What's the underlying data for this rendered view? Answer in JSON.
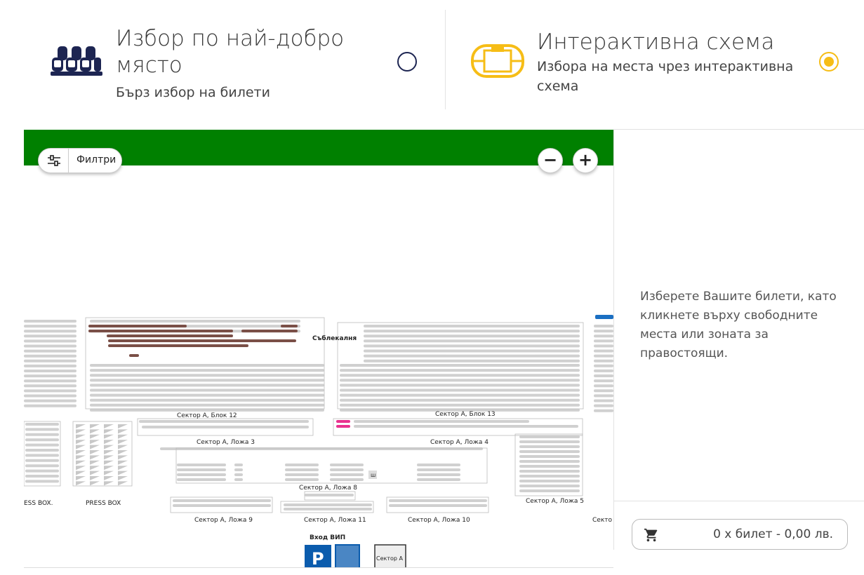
{
  "modes": {
    "best": {
      "title": "Избор по най-добро място",
      "subtitle": "Бърз избор на билети",
      "selected": false,
      "icon": "theater-seats-icon"
    },
    "map": {
      "title": "Интерактивна схема",
      "subtitle": "Избора на места чрез интерактивна схема",
      "selected": true,
      "icon": "stadium-icon"
    }
  },
  "map": {
    "filter_label": "Филтри",
    "zoom_out": "−",
    "zoom_in": "+",
    "labels": {
      "changing_room": "Съблекалня",
      "block12": "Сектор А, Блок 12",
      "block13": "Сектор А, Блок 13",
      "loge3": "Сектор А, Ложа 3",
      "loge4": "Сектор А, Ложа 4",
      "loge5": "Сектор А, Ложа 5",
      "loge8": "Сектор А, Ложа 8",
      "loge9": "Сектор А, Ложа 9",
      "loge10": "Сектор А, Ложа 10",
      "loge11": "Сектор А, Ложа 11",
      "press_left": "ESS BOX.",
      "press": "PRESS BOX",
      "vip_entrance": "Вход ВИП",
      "parking": "P",
      "sector_a": "Сектор А",
      "sector_cut": "Секто",
      "stairs": "ш"
    },
    "colors": {
      "pitch": "#008000",
      "seat_free": "#d0d0d0",
      "seat_brown": "#7a4f47",
      "seat_pink": "#e9328f",
      "parking": "#0b5cad",
      "blue_mark": "#1b6fc2"
    }
  },
  "sidebar": {
    "hint": "Изберете Вашите билети, като кликнете върху свободните места или зоната за правостоящи.",
    "cart": "0 x билет - 0,00 лв."
  }
}
